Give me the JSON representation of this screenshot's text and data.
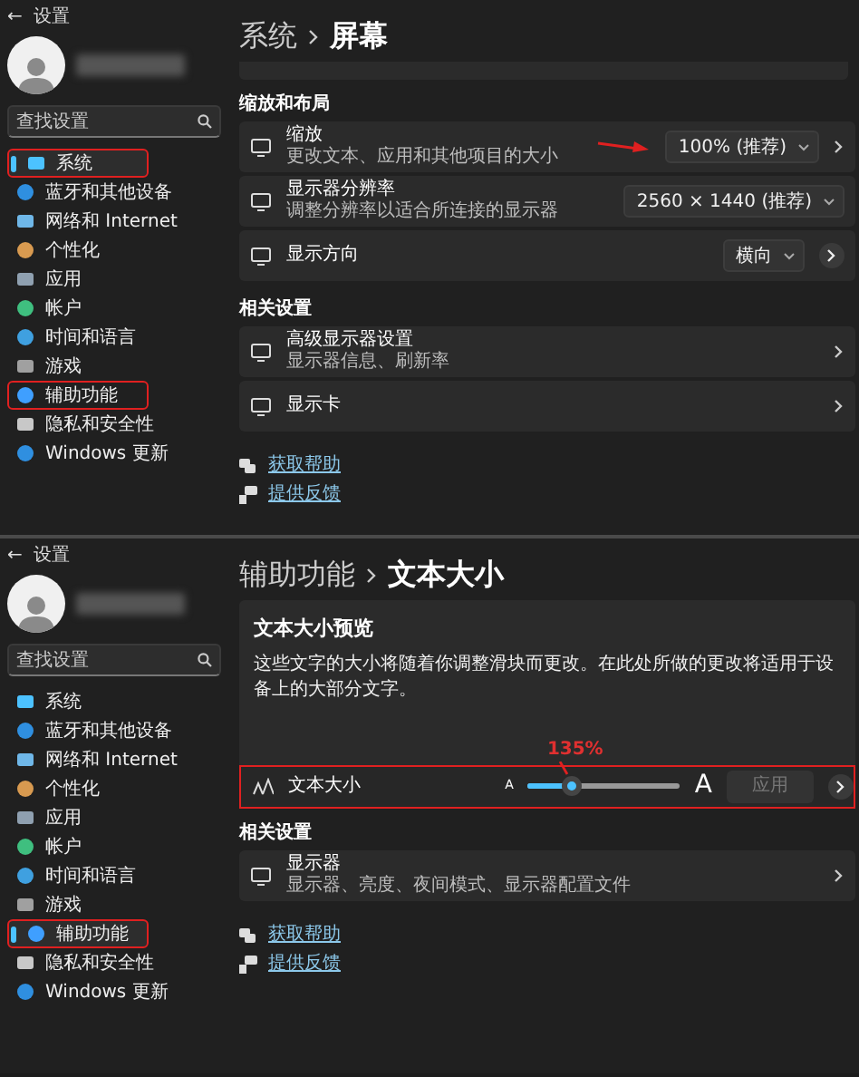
{
  "panels": [
    {
      "window": {
        "title": "设置",
        "back": "←"
      },
      "search": {
        "placeholder": "查找设置"
      },
      "sidebar": {
        "items": [
          {
            "label": "系统",
            "selected": true,
            "annotated": true
          },
          {
            "label": "蓝牙和其他设备",
            "selected": false,
            "annotated": false
          },
          {
            "label": "网络和 Internet",
            "selected": false,
            "annotated": false
          },
          {
            "label": "个性化",
            "selected": false,
            "annotated": false
          },
          {
            "label": "应用",
            "selected": false,
            "annotated": false
          },
          {
            "label": "帐户",
            "selected": false,
            "annotated": false
          },
          {
            "label": "时间和语言",
            "selected": false,
            "annotated": false
          },
          {
            "label": "游戏",
            "selected": false,
            "annotated": false
          },
          {
            "label": "辅助功能",
            "selected": false,
            "annotated": true
          },
          {
            "label": "隐私和安全性",
            "selected": false,
            "annotated": false
          },
          {
            "label": "Windows 更新",
            "selected": false,
            "annotated": false
          }
        ]
      },
      "breadcrumb": [
        "系统",
        "屏幕"
      ],
      "blocks": [
        {
          "kind": "cut-card"
        },
        {
          "kind": "heading",
          "text": "缩放和布局"
        },
        {
          "kind": "row",
          "title": "缩放",
          "subtitle": "更改文本、应用和其他项目的大小",
          "value": "100% (推荐)",
          "arrow": true,
          "chevron": true,
          "round_button": false
        },
        {
          "kind": "row",
          "title": "显示器分辨率",
          "subtitle": "调整分辨率以适合所连接的显示器",
          "value": "2560 × 1440 (推荐)",
          "arrow": false,
          "chevron": false,
          "round_button": false
        },
        {
          "kind": "row",
          "title": "显示方向",
          "value": "横向",
          "arrow": false,
          "chevron": false,
          "round_button": true
        },
        {
          "kind": "heading",
          "text": "相关设置"
        },
        {
          "kind": "row",
          "title": "高级显示器设置",
          "subtitle": "显示器信息、刷新率",
          "arrow": false,
          "chevron": true,
          "round_button": false
        },
        {
          "kind": "row",
          "title": "显示卡",
          "arrow": false,
          "chevron": true,
          "round_button": false
        }
      ],
      "links": [
        "获取帮助",
        "提供反馈"
      ]
    },
    {
      "window": {
        "title": "设置",
        "back": "←"
      },
      "search": {
        "placeholder": "查找设置"
      },
      "sidebar": {
        "items": [
          {
            "label": "系统",
            "selected": false,
            "annotated": false
          },
          {
            "label": "蓝牙和其他设备",
            "selected": false,
            "annotated": false
          },
          {
            "label": "网络和 Internet",
            "selected": false,
            "annotated": false
          },
          {
            "label": "个性化",
            "selected": false,
            "annotated": false
          },
          {
            "label": "应用",
            "selected": false,
            "annotated": false
          },
          {
            "label": "帐户",
            "selected": false,
            "annotated": false
          },
          {
            "label": "时间和语言",
            "selected": false,
            "annotated": false
          },
          {
            "label": "游戏",
            "selected": false,
            "annotated": false
          },
          {
            "label": "辅助功能",
            "selected": true,
            "annotated": true
          },
          {
            "label": "隐私和安全性",
            "selected": false,
            "annotated": false
          },
          {
            "label": "Windows 更新",
            "selected": false,
            "annotated": false
          }
        ]
      },
      "breadcrumb": [
        "辅助功能",
        "文本大小"
      ],
      "blocks": [
        {
          "kind": "preview",
          "title": "文本大小预览",
          "text": "这些文字的大小将随着你调整滑块而更改。在此处所做的更改将适用于设备上的大部分文字。",
          "slider": {
            "title": "文本大小",
            "min_label": "A",
            "max_label": "A",
            "level": 0.28,
            "annotation": "135%",
            "annotated": true,
            "apply": "应用",
            "apply_disabled": true
          }
        },
        {
          "kind": "heading",
          "text": "相关设置"
        },
        {
          "kind": "row",
          "title": "显示器",
          "subtitle": "显示器、亮度、夜间模式、显示器配置文件",
          "arrow": false,
          "chevron": true,
          "round_button": false
        }
      ],
      "links": [
        "获取帮助",
        "提供反馈"
      ]
    }
  ]
}
